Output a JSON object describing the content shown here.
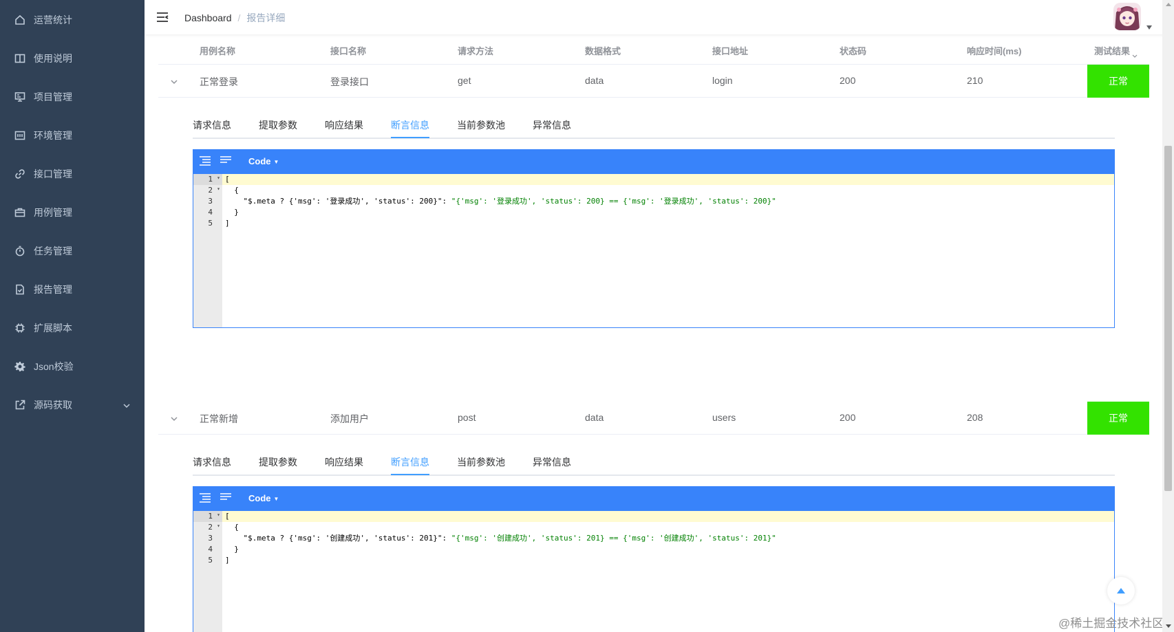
{
  "sidebar": {
    "items": [
      {
        "label": "运营统计",
        "icon": "home-icon"
      },
      {
        "label": "使用说明",
        "icon": "book-icon"
      },
      {
        "label": "项目管理",
        "icon": "monitor-icon"
      },
      {
        "label": "环境管理",
        "icon": "server-icon"
      },
      {
        "label": "接口管理",
        "icon": "link-icon"
      },
      {
        "label": "用例管理",
        "icon": "briefcase-icon"
      },
      {
        "label": "任务管理",
        "icon": "stopwatch-icon"
      },
      {
        "label": "报告管理",
        "icon": "document-check-icon"
      },
      {
        "label": "扩展脚本",
        "icon": "cpu-icon"
      },
      {
        "label": "Json校验",
        "icon": "gear-icon"
      },
      {
        "label": "源码获取",
        "icon": "external-link-icon"
      }
    ]
  },
  "navbar": {
    "breadcrumb_home": "Dashboard",
    "breadcrumb_separator": "/",
    "breadcrumb_current": "报告详细"
  },
  "table": {
    "headers": [
      "用例名称",
      "接口名称",
      "请求方法",
      "数据格式",
      "接口地址",
      "状态码",
      "响应时间(ms)",
      "测试结果"
    ],
    "rows": [
      {
        "case_name": "正常登录",
        "api_name": "登录接口",
        "method": "get",
        "format": "data",
        "path": "login",
        "status_code": "200",
        "response_time": "210",
        "result": "正常"
      },
      {
        "case_name": "正常新增",
        "api_name": "添加用户",
        "method": "post",
        "format": "data",
        "path": "users",
        "status_code": "200",
        "response_time": "208",
        "result": "正常"
      }
    ]
  },
  "tabs": [
    "请求信息",
    "提取参数",
    "响应结果",
    "断言信息",
    "当前参数池",
    "异常信息"
  ],
  "active_tab": "断言信息",
  "editor": {
    "mode_label": "Code",
    "line_numbers": [
      "1",
      "2",
      "3",
      "4",
      "5"
    ],
    "block1": {
      "line1": "[",
      "line2": "  {",
      "line3_key": "    \"$.meta ? {'msg': '登录成功', 'status': 200}\"",
      "line3_colon": ": ",
      "line3_value": "\"{'msg': '登录成功', 'status': 200} == {'msg': '登录成功', 'status': 200}\"",
      "line4": "  }",
      "line5": "]"
    },
    "block2": {
      "line1": "[",
      "line2": "  {",
      "line3_key": "    \"$.meta ? {'msg': '创建成功', 'status': 201}\"",
      "line3_colon": ": ",
      "line3_value": "\"{'msg': '创建成功', 'status': 201} == {'msg': '创建成功', 'status': 201}\"",
      "line4": "  }",
      "line5": "]"
    }
  },
  "colors": {
    "sidebar_bg": "#304156",
    "sidebar_text": "#bfcbd9",
    "editor_accent": "#3883fa",
    "result_ok": "#33e200",
    "tab_active": "#409eff",
    "string_color": "#008000"
  },
  "watermark": "@稀土掘金技术社区"
}
